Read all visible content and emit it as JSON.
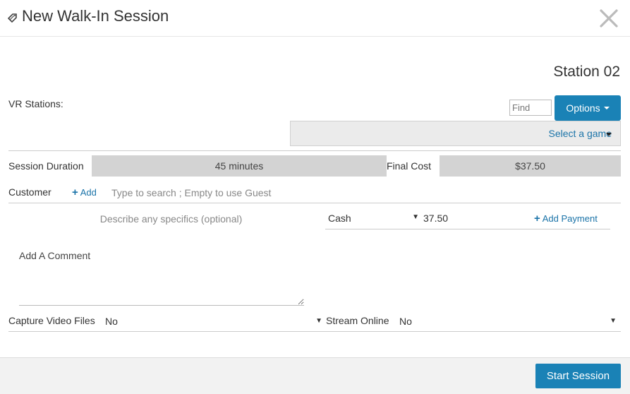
{
  "header": {
    "title": "New Walk-In Session",
    "icon": "tag-icon",
    "close_icon": "close-icon"
  },
  "station": {
    "name": "Station 02",
    "vr_label": "VR Stations:",
    "find_placeholder": "Find",
    "options_label": "Options",
    "game_select_label": "Select a game"
  },
  "session": {
    "duration_label": "Session Duration",
    "duration_value": "45 minutes",
    "cost_label": "Final Cost",
    "cost_value": "$37.50"
  },
  "customer": {
    "label": "Customer",
    "add_label": "Add",
    "search_placeholder": "Type to search ; Empty to use Guest"
  },
  "payment": {
    "description_placeholder": "Describe any specifics (optional)",
    "method": "Cash",
    "amount": "37.50",
    "add_payment_label": "Add Payment"
  },
  "comment": {
    "placeholder": "Add A Comment"
  },
  "capture": {
    "label": "Capture Video Files",
    "value": "No"
  },
  "stream": {
    "label": "Stream Online",
    "value": "No"
  },
  "footer": {
    "start_label": "Start Session"
  },
  "colors": {
    "primary": "#1a82b6",
    "link": "#1a73a8",
    "box_bg": "#d3d3d3"
  }
}
